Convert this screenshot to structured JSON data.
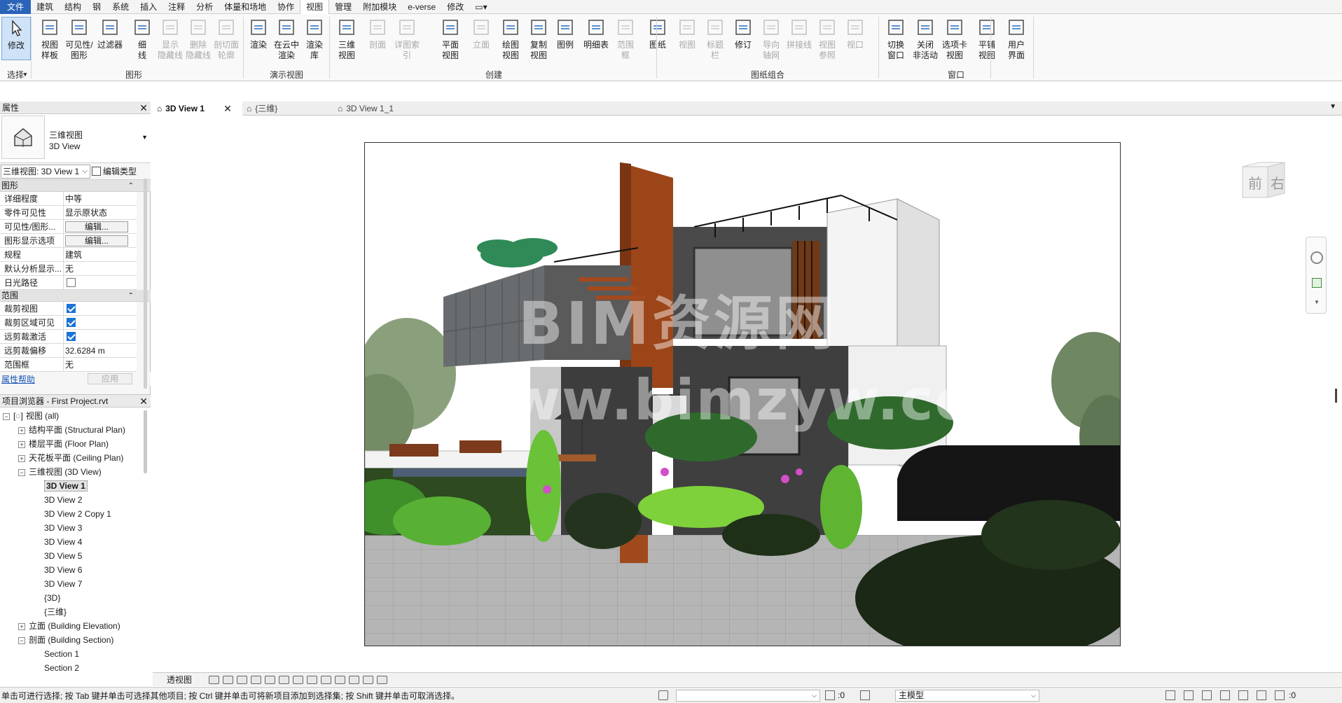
{
  "menu": {
    "tabs": [
      "文件",
      "建筑",
      "结构",
      "钢",
      "系统",
      "插入",
      "注释",
      "分析",
      "体量和场地",
      "协作",
      "视图",
      "管理",
      "附加模块",
      "e-verse",
      "修改"
    ],
    "active": "视图"
  },
  "ribbon": {
    "buttons": [
      {
        "label": "修改",
        "group": "select"
      },
      {
        "label": "视图\n样板"
      },
      {
        "label": "可见性/\n图形"
      },
      {
        "label": "过滤器"
      },
      {
        "label": "细\n线"
      },
      {
        "label": "显示\n隐藏线",
        "disabled": true
      },
      {
        "label": "删除\n隐藏线",
        "disabled": true
      },
      {
        "label": "剖切面\n轮廓",
        "disabled": true
      },
      {
        "label": "渲染"
      },
      {
        "label": "在云中\n渲染"
      },
      {
        "label": "渲染\n库"
      },
      {
        "label": "三维\n视图"
      },
      {
        "label": "剖面",
        "disabled": true
      },
      {
        "label": "详图索引",
        "disabled": true
      },
      {
        "label": "平面\n视图"
      },
      {
        "label": "立面",
        "disabled": true
      },
      {
        "label": "绘图\n视图"
      },
      {
        "label": "复制\n视图"
      },
      {
        "label": "图例"
      },
      {
        "label": "明细表"
      },
      {
        "label": "范围\n框",
        "disabled": true
      },
      {
        "label": "图纸"
      },
      {
        "label": "视图",
        "disabled": true
      },
      {
        "label": "标题\n栏",
        "disabled": true
      },
      {
        "label": "修订"
      },
      {
        "label": "导向\n轴网",
        "disabled": true
      },
      {
        "label": "拼接线",
        "disabled": true
      },
      {
        "label": "视图\n参照",
        "disabled": true
      },
      {
        "label": "视口",
        "disabled": true
      },
      {
        "label": "切换\n窗口"
      },
      {
        "label": "关闭\n非活动"
      },
      {
        "label": "选项卡\n视图"
      },
      {
        "label": "平铺\n视图"
      },
      {
        "label": "用户\n界面"
      }
    ],
    "groups": {
      "select": "选择",
      "graphics": "图形",
      "presentation": "演示视图",
      "create": "创建",
      "sheet": "图纸组合",
      "windows": "窗口"
    }
  },
  "properties": {
    "title": "属性",
    "type_name_zh": "三维视图",
    "type_name_en": "3D View",
    "instance_selector": "三维视图: 3D View 1",
    "edit_type": "编辑类型",
    "sections": [
      {
        "name": "图形",
        "rows": [
          {
            "k": "详细程度",
            "v": "中等"
          },
          {
            "k": "零件可见性",
            "v": "显示原状态"
          },
          {
            "k": "可见性/图形...",
            "btn": "编辑..."
          },
          {
            "k": "图形显示选项",
            "btn": "编辑..."
          },
          {
            "k": "规程",
            "v": "建筑"
          },
          {
            "k": "默认分析显示...",
            "v": "无"
          },
          {
            "k": "日光路径",
            "check": false
          }
        ]
      },
      {
        "name": "范围",
        "rows": [
          {
            "k": "裁剪视图",
            "check": true
          },
          {
            "k": "裁剪区域可见",
            "check": true
          },
          {
            "k": "远剪裁激活",
            "check": true
          },
          {
            "k": "远剪裁偏移",
            "v": "32.6284 m"
          },
          {
            "k": "范围框",
            "v": "无"
          }
        ]
      }
    ],
    "help": "属性帮助",
    "apply": "应用"
  },
  "browser": {
    "title": "项目浏览器 - First Project.rvt",
    "nodes": [
      {
        "t": "视图 (all)",
        "lvl": 0,
        "tg": "−",
        "icon": true
      },
      {
        "t": "结构平面 (Structural Plan)",
        "lvl": 1,
        "tg": "+"
      },
      {
        "t": "楼层平面 (Floor Plan)",
        "lvl": 1,
        "tg": "+"
      },
      {
        "t": "天花板平面 (Ceiling Plan)",
        "lvl": 1,
        "tg": "+"
      },
      {
        "t": "三维视图 (3D View)",
        "lvl": 1,
        "tg": "−"
      },
      {
        "t": "3D View 1",
        "lvl": 2,
        "sel": true
      },
      {
        "t": "3D View 2",
        "lvl": 2
      },
      {
        "t": "3D View 2 Copy 1",
        "lvl": 2
      },
      {
        "t": "3D View 3",
        "lvl": 2
      },
      {
        "t": "3D View 4",
        "lvl": 2
      },
      {
        "t": "3D View 5",
        "lvl": 2
      },
      {
        "t": "3D View 6",
        "lvl": 2
      },
      {
        "t": "3D View 7",
        "lvl": 2
      },
      {
        "t": "{3D}",
        "lvl": 2
      },
      {
        "t": "{三维}",
        "lvl": 2
      },
      {
        "t": "立面 (Building Elevation)",
        "lvl": 1,
        "tg": "+"
      },
      {
        "t": "剖面 (Building Section)",
        "lvl": 1,
        "tg": "−"
      },
      {
        "t": "Section 1",
        "lvl": 2
      },
      {
        "t": "Section 2",
        "lvl": 2
      }
    ]
  },
  "view_tabs": [
    {
      "label": "3D View 1",
      "active": true
    },
    {
      "label": "{三维}"
    },
    {
      "label": "3D View 1_1"
    }
  ],
  "viewport": {
    "watermark_cn": "BIM资源网",
    "watermark_url": "www.bimzyw.com"
  },
  "viewcube": {
    "front": "前",
    "right": "右"
  },
  "view_control": {
    "mode": "透视图"
  },
  "status": {
    "message": "单击可进行选择; 按 Tab 键并单击可选择其他项目; 按 Ctrl 键并单击可将新项目添加到选择集; 按 Shift 键并单击可取消选择。",
    "count_left": ":0",
    "model": "主模型",
    "filter_count": ":0"
  },
  "colors": {
    "file_tab": "#2b63b8",
    "accent": "#1b73d4",
    "orange_wall": "#a0461a",
    "dark_wall": "#3c3c3c",
    "hedge": "#2e4a20"
  }
}
